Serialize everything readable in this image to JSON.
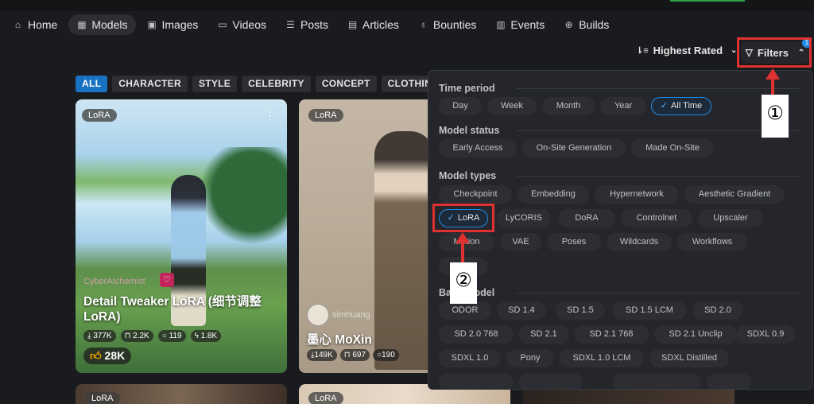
{
  "nav": {
    "items": [
      {
        "label": "Home",
        "icon": "home-icon",
        "active": false
      },
      {
        "label": "Models",
        "icon": "grid-icon",
        "active": true
      },
      {
        "label": "Images",
        "icon": "image-icon",
        "active": false
      },
      {
        "label": "Videos",
        "icon": "video-icon",
        "active": false
      },
      {
        "label": "Posts",
        "icon": "posts-icon",
        "active": false
      },
      {
        "label": "Articles",
        "icon": "article-icon",
        "active": false
      },
      {
        "label": "Bounties",
        "icon": "moneybag-icon",
        "active": false
      },
      {
        "label": "Events",
        "icon": "calendar-icon",
        "active": false
      },
      {
        "label": "Builds",
        "icon": "cpu-icon",
        "active": false
      }
    ]
  },
  "sort": {
    "label": "Highest Rated"
  },
  "filters": {
    "label": "Filters",
    "count": "1"
  },
  "categories": [
    "ALL",
    "CHARACTER",
    "STYLE",
    "CELEBRITY",
    "CONCEPT",
    "CLOTHING"
  ],
  "cards": [
    {
      "badge": "LoRA",
      "creator": "CyberAIchemist",
      "title": "Detail Tweaker LoRA (细节调整 LoRA)",
      "downloads": "377K",
      "saves": "2.2K",
      "comments": "119",
      "buzz": "1.8K",
      "likes": "28K"
    },
    {
      "badge": "LoRA",
      "creator": "simhuang",
      "title": "墨心 MoXin",
      "downloads": "149K",
      "saves": "697",
      "comments": "190"
    }
  ],
  "more_cards": [
    {
      "badge": "LoRA"
    },
    {
      "badge": "LoRA"
    }
  ],
  "panel": {
    "time_period": {
      "title": "Time period",
      "options": [
        "Day",
        "Week",
        "Month",
        "Year",
        "All Time"
      ],
      "selected": "All Time"
    },
    "model_status": {
      "title": "Model status",
      "options": [
        "Early Access",
        "On-Site Generation",
        "Made On-Site"
      ]
    },
    "model_types": {
      "title": "Model types",
      "options": [
        "Checkpoint",
        "Embedding",
        "Hypernetwork",
        "Aesthetic Gradient",
        "LoRA",
        "LyCORIS",
        "DoRA",
        "Controlnet",
        "Upscaler",
        "Motion",
        "VAE",
        "Poses",
        "Wildcards",
        "Workflows"
      ],
      "selected": "LoRA"
    },
    "base_model": {
      "title": "Base model",
      "options": [
        "ODOR",
        "SD 1.4",
        "SD 1.5",
        "SD 1.5 LCM",
        "SD 2.0",
        "SD 2.0 768",
        "SD 2.1",
        "SD 2.1 768",
        "SD 2.1 Unclip",
        "SDXL 0.9",
        "SDXL 1.0",
        "Pony",
        "SDXL 1.0 LCM",
        "SDXL Distilled"
      ]
    }
  },
  "annotations": [
    "①",
    "②"
  ],
  "colors": {
    "accent": "#228be6",
    "highlight": "#e03131",
    "background": "#1a1b1e",
    "panel": "#25262b"
  }
}
